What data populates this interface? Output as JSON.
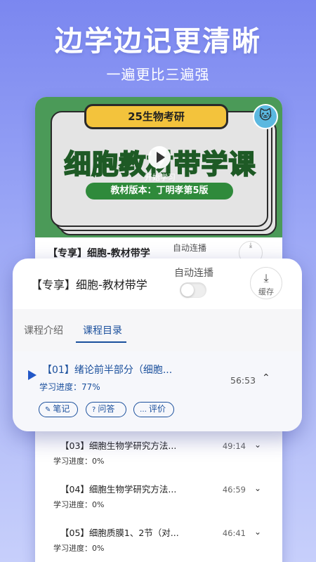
{
  "headline": "边学边记更清晰",
  "subline": "一遍更比三遍强",
  "video": {
    "tag": "25生物考研",
    "big_title": "细胞教材带学课",
    "start": "开始学习",
    "edition": "教材版本：丁明孝第5版"
  },
  "course": {
    "title": "【专享】细胞-教材带学",
    "autoplay_label": "自动连播",
    "save_label": "缓存"
  },
  "tabs": [
    {
      "label": "课程介绍",
      "active": false
    },
    {
      "label": "课程目录",
      "active": true
    }
  ],
  "active_lesson": {
    "title": "【01】绪论前半部分（细胞...",
    "duration": "56:53",
    "progress": "学习进度：77%",
    "actions": [
      "笔记",
      "问答",
      "评价"
    ]
  },
  "lessons": [
    {
      "title": "【03】细胞生物学研究方法...",
      "progress": "学习进度：0%",
      "duration": "49:14"
    },
    {
      "title": "【04】细胞生物学研究方法...",
      "progress": "学习进度：0%",
      "duration": "46:59"
    },
    {
      "title": "【05】细胞质膜1、2节（对...",
      "progress": "学习进度：0%",
      "duration": "46:41"
    }
  ],
  "colors": {
    "accent": "#1a4f9c",
    "play_arrow": "#2257c7",
    "background": "#8c98f3"
  }
}
